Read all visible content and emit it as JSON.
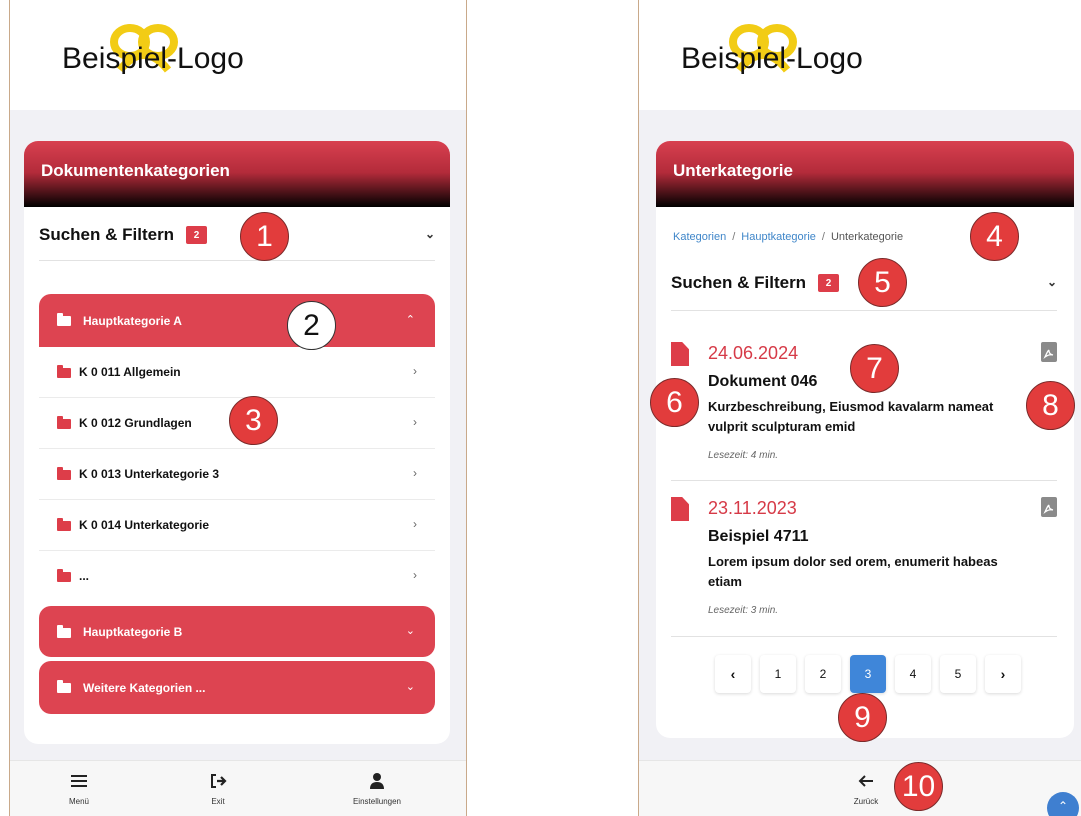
{
  "brand": {
    "logo_text": "Beispiel-Logo",
    "accent_color": "#dd3d49",
    "pretzel_color": "#f2cc15"
  },
  "left": {
    "card_title": "Dokumentenkategorien",
    "filter": {
      "label": "Suchen & Filtern",
      "badge": "2",
      "chevron": "chevron-down-icon"
    },
    "categories": [
      {
        "label": "Hauptkategorie A",
        "expanded": true
      },
      {
        "label": "Hauptkategorie B",
        "expanded": false
      },
      {
        "label": "Weitere Kategorien ...",
        "expanded": false
      }
    ],
    "subcategories": [
      {
        "label": "K 0 011 Allgemein"
      },
      {
        "label": "K 0 012 Grundlagen"
      },
      {
        "label": "K 0 013 Unterkategorie 3"
      },
      {
        "label": "K 0 014 Unterkategorie"
      },
      {
        "label": "..."
      }
    ],
    "bottom_nav": [
      {
        "label": "Menü",
        "icon": "menu-icon"
      },
      {
        "label": "Exit",
        "icon": "exit-icon"
      },
      {
        "label": "Einstellungen",
        "icon": "user-icon"
      }
    ]
  },
  "right": {
    "card_title": "Unterkategorie",
    "breadcrumb": {
      "items": [
        "Kategorien",
        "Hauptkategorie",
        "Unterkategorie"
      ],
      "separator": "/"
    },
    "filter": {
      "label": "Suchen & Filtern",
      "badge": "2"
    },
    "documents": [
      {
        "date": "24.06.2024",
        "title": "Dokument 046",
        "description": "Kurzbeschreibung, Eiusmod kavalarm nameat vulprit sculpturam emid",
        "reading_time": "Lesezeit: 4 min."
      },
      {
        "date": "23.11.2023",
        "title": "Beispiel 4711",
        "description": "Lorem ipsum dolor sed orem, enumerit habeas etiam",
        "reading_time": "Lesezeit: 3 min."
      }
    ],
    "pagination": {
      "prev": "‹",
      "next": "›",
      "pages": [
        "1",
        "2",
        "3",
        "4",
        "5"
      ],
      "current": "3"
    },
    "back_label": "Zurück"
  },
  "markers": [
    "1",
    "2",
    "3",
    "4",
    "5",
    "6",
    "7",
    "8",
    "9",
    "10"
  ]
}
